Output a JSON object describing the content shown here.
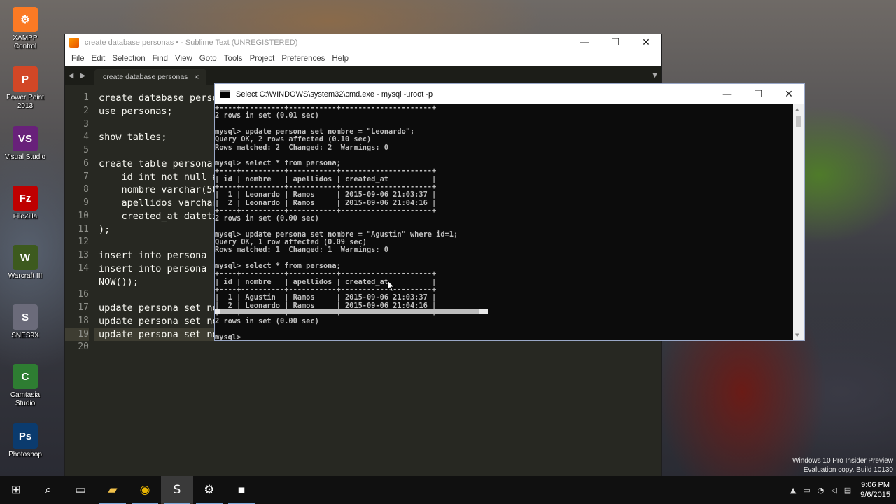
{
  "desktop_icons": [
    {
      "label": "XAMPP\nControl",
      "icon": "xampp-icon",
      "color": "#fb7a24",
      "glyph": "⚙"
    },
    {
      "label": "Power Point\n2013",
      "icon": "powerpoint-icon",
      "color": "#d24726",
      "glyph": "P"
    },
    {
      "label": "Visual Studio",
      "icon": "visual-studio-icon",
      "color": "#68217a",
      "glyph": "VS"
    },
    {
      "label": "FileZilla",
      "icon": "filezilla-icon",
      "color": "#bf0000",
      "glyph": "Fz"
    },
    {
      "label": "Warcraft III",
      "icon": "warcraft-icon",
      "color": "#3d5a1e",
      "glyph": "W"
    },
    {
      "label": "SNES9X",
      "icon": "snes9x-icon",
      "color": "#6b6b7a",
      "glyph": "S"
    },
    {
      "label": "Camtasia\nStudio",
      "icon": "camtasia-icon",
      "color": "#2e7d32",
      "glyph": "C"
    },
    {
      "label": "Photoshop",
      "icon": "photoshop-icon",
      "color": "#0b3b6e",
      "glyph": "Ps"
    }
  ],
  "sublime": {
    "title": "create database personas • - Sublime Text (UNREGISTERED)",
    "menu": [
      "File",
      "Edit",
      "Selection",
      "Find",
      "View",
      "Goto",
      "Tools",
      "Project",
      "Preferences",
      "Help"
    ],
    "tab_name": "create database personas",
    "close_glyph": "×",
    "line_numbers": [
      "1",
      "2",
      "3",
      "4",
      "5",
      "6",
      "7",
      "8",
      "9",
      "10",
      "11",
      "12",
      "13",
      "14",
      "",
      "16",
      "17",
      "18",
      "19",
      "20"
    ],
    "code_lines": [
      "create database personas;",
      "use personas;",
      "",
      "show tables;",
      "",
      "create table persona(",
      "    id int not null auto_increment,",
      "    nombre varchar(50),",
      "    apellidos varchar(100),",
      "    created_at datetime,",
      ");",
      "",
      "insert into persona",
      "insert into persona",
      "NOW());",
      "",
      "update persona set nombre = \"Leonardo\";",
      "update persona set nombre = \"Agustin\" where id=1;",
      "update persona set nombre = \"Sebastian\" where id=2;",
      ""
    ],
    "current_line_index": 18
  },
  "cmd": {
    "title": "Select C:\\WINDOWS\\system32\\cmd.exe - mysql  -uroot -p",
    "lines": [
      "+----+----------+-----------+---------------------+",
      "2 rows in set (0.01 sec)",
      "",
      "mysql> update persona set nombre = \"Leonardo\";",
      "Query OK, 2 rows affected (0.10 sec)",
      "Rows matched: 2  Changed: 2  Warnings: 0",
      "",
      "mysql> select * from persona;",
      "+----+----------+-----------+---------------------+",
      "| id | nombre   | apellidos | created_at          |",
      "+----+----------+-----------+---------------------+",
      "|  1 | Leonardo | Ramos     | 2015-09-06 21:03:37 |",
      "|  2 | Leonardo | Ramos     | 2015-09-06 21:04:16 |",
      "+----+----------+-----------+---------------------+",
      "2 rows in set (0.00 sec)",
      "",
      "mysql> update persona set nombre = \"Agustin\" where id=1;",
      "Query OK, 1 row affected (0.09 sec)",
      "Rows matched: 1  Changed: 1  Warnings: 0",
      "",
      "mysql> select * from persona;",
      "+----+----------+-----------+---------------------+",
      "| id | nombre   | apellidos | created_at          |",
      "+----+----------+-----------+---------------------+",
      "|  1 | Agustin  | Ramos     | 2015-09-06 21:03:37 |",
      "|  2 | Leonardo | Ramos     | 2015-09-06 21:04:16 |",
      "+----+----------+-----------+---------------------+",
      "2 rows in set (0.00 sec)",
      "",
      "mysql> _"
    ]
  },
  "watermark": {
    "line1": "Windows 10 Pro Insider Preview",
    "line2": "Evaluation copy. Build 10130"
  },
  "taskbar": {
    "items": [
      {
        "name": "start-button",
        "icon": "windows-logo-icon",
        "glyph": "⊞"
      },
      {
        "name": "search-button",
        "icon": "search-icon",
        "glyph": "⌕"
      },
      {
        "name": "task-view-button",
        "icon": "task-view-icon",
        "glyph": "▭"
      },
      {
        "name": "file-explorer-button",
        "icon": "folder-icon",
        "glyph": "▰"
      },
      {
        "name": "chrome-button",
        "icon": "chrome-icon",
        "glyph": "◉"
      },
      {
        "name": "sublime-text-button",
        "icon": "sublime-text-icon",
        "glyph": "S"
      },
      {
        "name": "xampp-button",
        "icon": "xampp-icon",
        "glyph": "⚙"
      },
      {
        "name": "cmd-button",
        "icon": "cmd-icon",
        "glyph": "▪"
      }
    ],
    "tray_up_glyph": "▲",
    "clock_time": "9:06 PM",
    "clock_date": "9/6/2015"
  },
  "window_controls": {
    "minimize": "—",
    "maximize": "☐",
    "close": "✕"
  }
}
